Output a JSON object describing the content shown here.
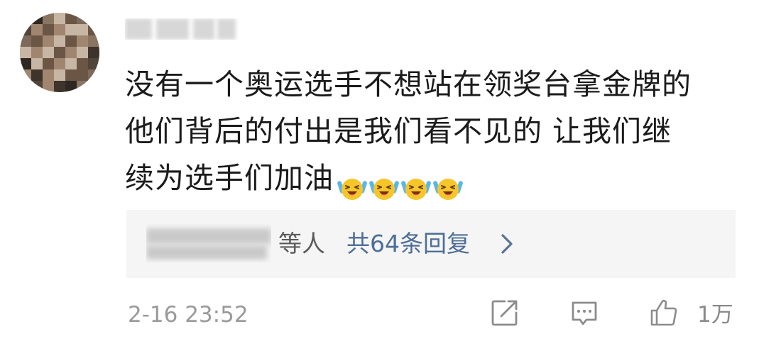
{
  "comment": {
    "avatar": {
      "icon": "blurred-avatar-icon"
    },
    "lines": [
      "没有一个奥运选手不想站在领奖台拿金牌的",
      "他们背后的付出是我们看不见的 让我们继",
      "续为选手们加油"
    ],
    "emoji": {
      "icon": "crying-laughing-emoji-icon",
      "count": 4,
      "face_color": "#f7c52a",
      "tear_color": "#58b6ea"
    }
  },
  "replies": {
    "suffix": "等人",
    "count_label": "共64条回复",
    "chevron_icon": "chevron-right-icon",
    "link_color": "#4e6e98",
    "background": "#f5f5f5"
  },
  "footer": {
    "timestamp": "2-16 23:52",
    "share_icon": "share-icon",
    "comment_icon": "comment-icon",
    "like_icon": "thumbs-up-icon",
    "like_count": "1万"
  }
}
